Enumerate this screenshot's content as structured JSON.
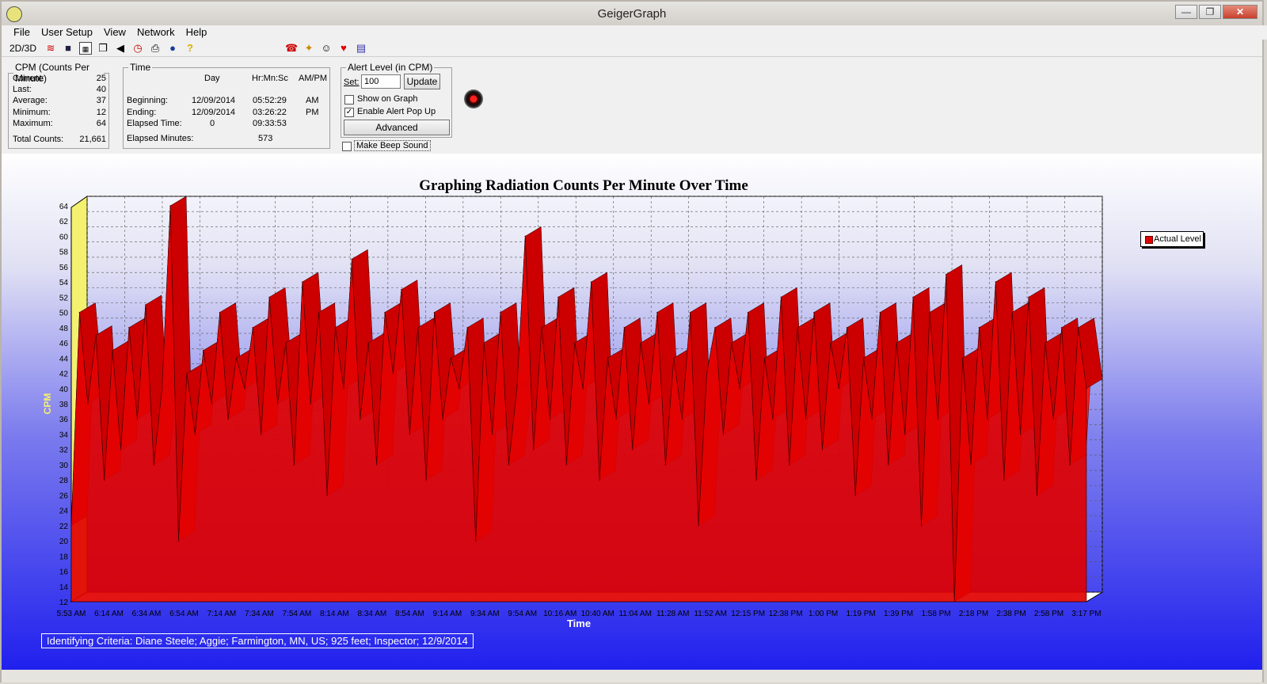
{
  "window": {
    "title": "GeigerGraph",
    "minimize": "—",
    "maximize": "❐",
    "close": "✕"
  },
  "menu": [
    "File",
    "User Setup",
    "View",
    "Network",
    "Help"
  ],
  "toolbar": {
    "mode_label": "2D/3D"
  },
  "cpm_panel": {
    "legend": "CPM (Counts Per Minute)",
    "rows": [
      {
        "label": "Current:",
        "value": "25"
      },
      {
        "label": "Last:",
        "value": "40"
      },
      {
        "label": "Average:",
        "value": "37"
      },
      {
        "label": "Minimum:",
        "value": "12"
      },
      {
        "label": "Maximum:",
        "value": "64"
      }
    ],
    "total_label": "Total Counts:",
    "total_value": "21,661"
  },
  "time_panel": {
    "legend": "Time",
    "col_day": "Day",
    "col_hms": "Hr:Mn:Sc",
    "col_ampm": "AM/PM",
    "beginning_label": "Beginning:",
    "beginning_day": "12/09/2014",
    "beginning_time": "05:52:29",
    "beginning_ampm": "AM",
    "ending_label": "Ending:",
    "ending_day": "12/09/2014",
    "ending_time": "03:26:22",
    "ending_ampm": "PM",
    "elapsed_label": "Elapsed Time:",
    "elapsed_day": "0",
    "elapsed_time": "09:33:53",
    "elapsed_min_label": "Elapsed Minutes:",
    "elapsed_min_value": "573"
  },
  "alert_panel": {
    "legend": "Alert Level (in CPM)",
    "set_label": "Set:",
    "set_value": "100",
    "update_label": "Update",
    "show_on_graph_label": "Show on Graph",
    "show_on_graph_checked": false,
    "enable_popup_label": "Enable Alert Pop Up",
    "enable_popup_checked": true,
    "advanced_label": "Advanced",
    "beep_label": "Make Beep Sound",
    "beep_checked": false
  },
  "ident": "Identifying Criteria:  Diane Steele;  Aggie;  Farmington, MN, US;  925 feet;  Inspector;  12/9/2014",
  "chart_data": {
    "type": "area",
    "title": "Graphing Radiation Counts Per Minute Over Time",
    "xlabel": "Time",
    "ylabel": "CPM",
    "ylim": [
      12,
      64
    ],
    "yticks": [
      12,
      14,
      16,
      18,
      20,
      22,
      24,
      26,
      28,
      30,
      32,
      34,
      36,
      38,
      40,
      42,
      44,
      46,
      48,
      50,
      52,
      54,
      56,
      58,
      60,
      62,
      64
    ],
    "x_ticks": [
      "5:53 AM",
      "6:14 AM",
      "6:34 AM",
      "6:54 AM",
      "7:14 AM",
      "7:34 AM",
      "7:54 AM",
      "8:14 AM",
      "8:34 AM",
      "8:54 AM",
      "9:14 AM",
      "9:34 AM",
      "9:54 AM",
      "10:16 AM",
      "10:40 AM",
      "11:04 AM",
      "11:28 AM",
      "11:52 AM",
      "12:15 PM",
      "12:38 PM",
      "1:00 PM",
      "1:19 PM",
      "1:39 PM",
      "1:58 PM",
      "2:18 PM",
      "2:38 PM",
      "2:58 PM",
      "3:17 PM"
    ],
    "series": [
      {
        "name": "Actual Level",
        "color": "#e00000",
        "values": [
          22,
          50,
          38,
          47,
          28,
          45,
          32,
          48,
          36,
          51,
          30,
          40,
          64,
          20,
          42,
          34,
          45,
          38,
          50,
          36,
          44,
          40,
          48,
          34,
          52,
          38,
          46,
          30,
          54,
          38,
          50,
          26,
          48,
          40,
          57,
          36,
          46,
          30,
          50,
          42,
          53,
          34,
          48,
          28,
          50,
          36,
          44,
          40,
          48,
          20,
          46,
          34,
          50,
          30,
          40,
          60,
          32,
          48,
          36,
          52,
          30,
          46,
          40,
          54,
          28,
          44,
          36,
          48,
          32,
          46,
          38,
          50,
          30,
          44,
          36,
          50,
          22,
          42,
          48,
          34,
          46,
          40,
          50,
          28,
          44,
          36,
          52,
          30,
          48,
          36,
          50,
          32,
          46,
          40,
          48,
          26,
          44,
          36,
          50,
          30,
          46,
          34,
          52,
          22,
          50,
          36,
          55,
          12,
          44,
          30,
          48,
          36,
          54,
          28,
          50,
          34,
          52,
          26,
          46,
          36,
          48,
          30,
          48,
          40
        ]
      }
    ],
    "legend_position": "right"
  }
}
